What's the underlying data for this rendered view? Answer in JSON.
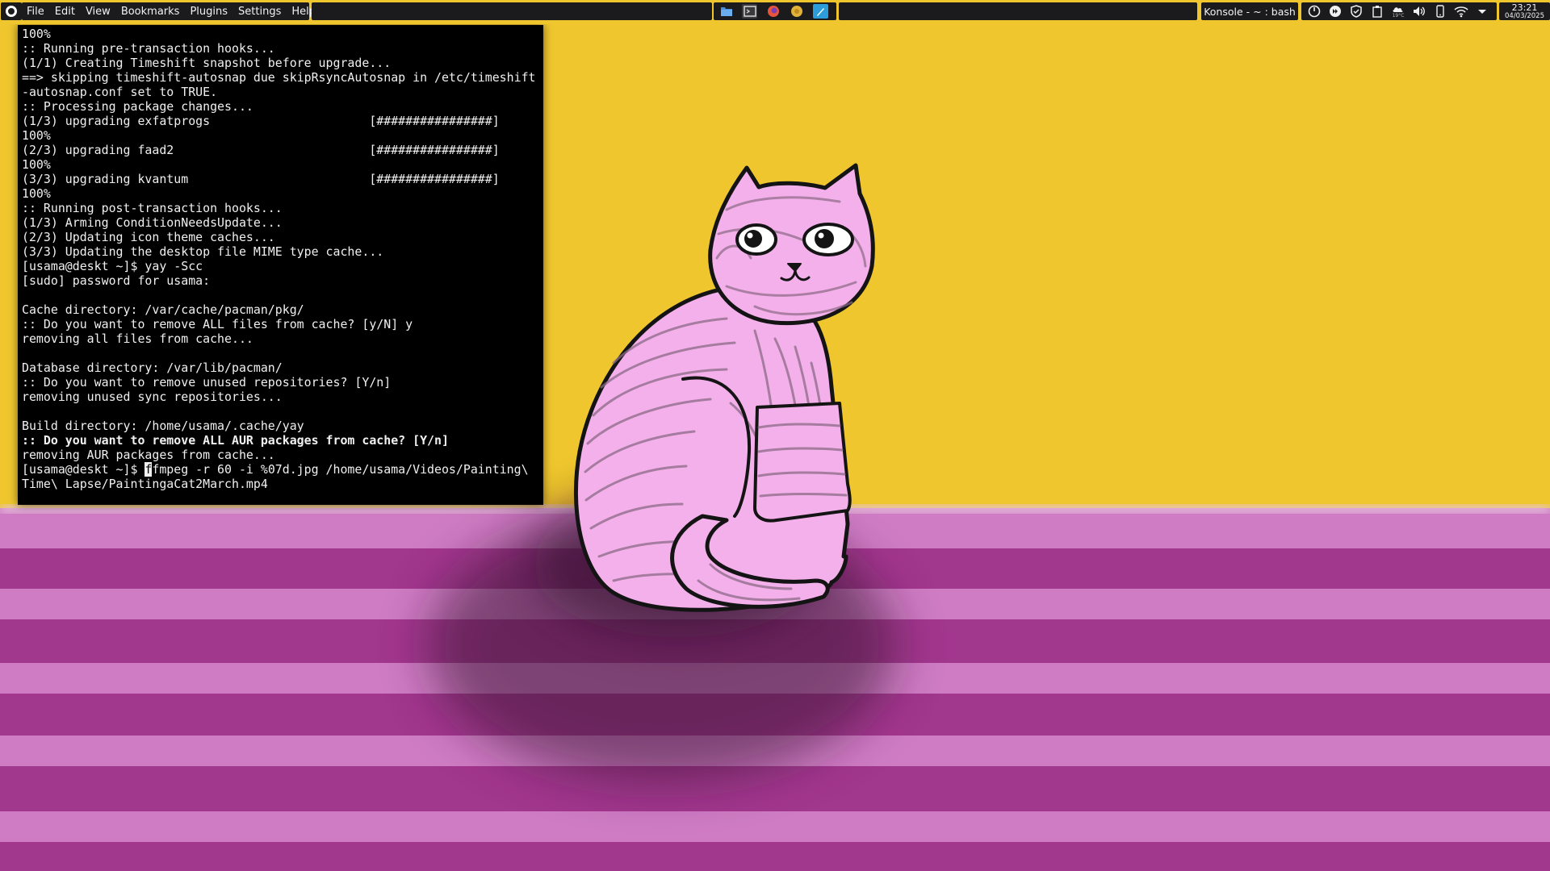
{
  "menu": {
    "items": [
      "File",
      "Edit",
      "View",
      "Bookmarks",
      "Plugins",
      "Settings",
      "Help"
    ]
  },
  "taskbar": {
    "active_task": "Konsole - ~ : bash",
    "pinned_apps": [
      "dolphin-icon",
      "konsole-icon",
      "firefox-icon",
      "chromium-icon",
      "kate-icon"
    ]
  },
  "tray": {
    "weather_temp": "19°C",
    "icons": [
      "power-icon",
      "media-icon",
      "shield-icon",
      "clipboard-icon",
      "weather-icon",
      "volume-icon",
      "phone-icon",
      "wifi-icon",
      "expand-arrow-icon"
    ]
  },
  "clock": {
    "time": "23:21",
    "date": "04/03/2025"
  },
  "terminal": {
    "lines": [
      "100%",
      ":: Running pre-transaction hooks...",
      "(1/1) Creating Timeshift snapshot before upgrade...",
      "==> skipping timeshift-autosnap due skipRsyncAutosnap in /etc/timeshift",
      "-autosnap.conf set to TRUE.",
      ":: Processing package changes...",
      "(1/3) upgrading exfatprogs                      [################]",
      "100%",
      "(2/3) upgrading faad2                           [################]",
      "100%",
      "(3/3) upgrading kvantum                         [################]",
      "100%",
      ":: Running post-transaction hooks...",
      "(1/3) Arming ConditionNeedsUpdate...",
      "(2/3) Updating icon theme caches...",
      "(3/3) Updating the desktop file MIME type cache...",
      "[usama@deskt ~]$ yay -Scc",
      "[sudo] password for usama:",
      "",
      "Cache directory: /var/cache/pacman/pkg/",
      ":: Do you want to remove ALL files from cache? [y/N] y",
      "removing all files from cache...",
      "",
      "Database directory: /var/lib/pacman/",
      ":: Do you want to remove unused repositories? [Y/n]",
      "removing unused sync repositories...",
      "",
      "Build directory: /home/usama/.cache/yay",
      ":: Do you want to remove ALL AUR packages from cache? [Y/n]",
      "removing AUR packages from cache..."
    ],
    "bold_line_index": 28,
    "prompt": "[usama@deskt ~]$ ",
    "cursor_char": "f",
    "command_rest": "fmpeg -r 60 -i %07d.jpg /home/usama/Videos/Painting\\",
    "command_wrap": "Time\\ Lapse/PaintingaCat2March.mp4"
  },
  "colors": {
    "wall": "#efc62e",
    "floor_dark": "#a2378e",
    "floor_light": "#cf7cc4",
    "cat_fill": "#f4b0ea",
    "panel": "#1b1b1d",
    "terminal_bg": "#000000"
  }
}
